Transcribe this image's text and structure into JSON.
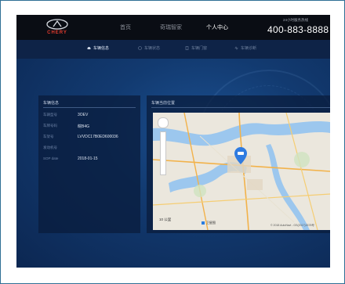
{
  "brand": {
    "logo_text": "CHERY",
    "accent": "#e23b2e"
  },
  "nav": {
    "items": [
      {
        "label": "首页",
        "active": false
      },
      {
        "label": "奇瑞智家",
        "active": false
      },
      {
        "label": "个人中心",
        "active": true
      }
    ]
  },
  "hotline": {
    "label": "24小时服务热线",
    "number": "400-883-8888"
  },
  "subnav": {
    "tabs": [
      {
        "label": "车辆信息",
        "icon": "car-icon",
        "active": true
      },
      {
        "label": "车辆状态",
        "icon": "status-icon",
        "active": false
      },
      {
        "label": "车辆门窗",
        "icon": "door-icon",
        "active": false
      },
      {
        "label": "车辆诊断",
        "icon": "diagnose-icon",
        "active": false
      }
    ]
  },
  "vehicle_info": {
    "title": "车辆信息",
    "rows": [
      {
        "label": "车辆型号",
        "value": "3OEV"
      },
      {
        "label": "车牌号码",
        "value": "皖B4G"
      },
      {
        "label": "车架号",
        "value": "LVVDC17B0ED600036"
      },
      {
        "label": "发动机号",
        "value": ""
      },
      {
        "label": "SOP date",
        "value": "2018-01-15"
      }
    ]
  },
  "map_panel": {
    "title": "车辆当前位置",
    "scale": "10 公里",
    "map_type_label": "卫星图",
    "copyright": "© 2018 AutoNavi - GS(2017)3378号",
    "marker_icon": "car-location-icon"
  },
  "colors": {
    "background": "#0e2a55",
    "header": "#0a0d14",
    "panel": "#0a1c3c"
  }
}
